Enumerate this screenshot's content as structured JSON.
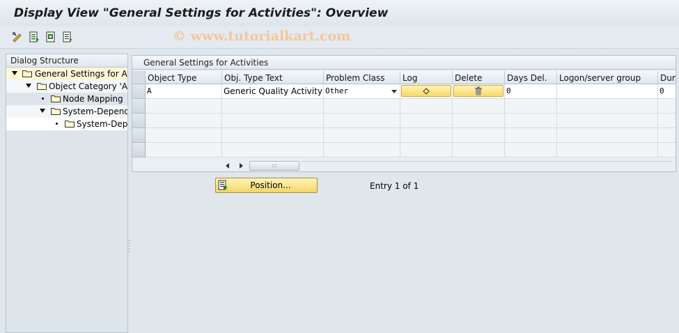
{
  "window": {
    "title": "Display View \"General Settings for Activities\": Overview"
  },
  "toolbar": {
    "icons": [
      "display-change-icon",
      "details-icon",
      "export-icon",
      "print-icon"
    ],
    "watermark": "© www.tutorialkart.com"
  },
  "dialog_structure": {
    "header": "Dialog Structure",
    "items": [
      {
        "label": "General Settings for Act",
        "level": 0,
        "expanded": true,
        "selected": true
      },
      {
        "label": "Object Category 'Act",
        "level": 1,
        "expanded": true,
        "selected": false
      },
      {
        "label": "Node Mapping",
        "level": 2,
        "expanded": false,
        "selected": false
      },
      {
        "label": "System-Depende",
        "level": 2,
        "expanded": true,
        "selected": false
      },
      {
        "label": "System-Depe",
        "level": 3,
        "expanded": false,
        "selected": false
      }
    ]
  },
  "table": {
    "title": "General Settings for Activities",
    "columns": [
      "Object Type",
      "Obj. Type Text",
      "Problem Class",
      "Log",
      "Delete",
      "Days Del.",
      "Logon/server group",
      "Dura"
    ],
    "rows": [
      {
        "object_type": "A",
        "obj_type_text": "Generic Quality Activity",
        "problem_class": "Other",
        "days_del": "0",
        "logon_server_group": "",
        "duration": "0"
      }
    ]
  },
  "footer": {
    "position_button": "Position...",
    "entry_text": "Entry 1 of 1"
  },
  "colors": {
    "button_yellow": "#f7d96b",
    "selected_tree": "#fff8d8",
    "background": "#dfe6ec"
  }
}
